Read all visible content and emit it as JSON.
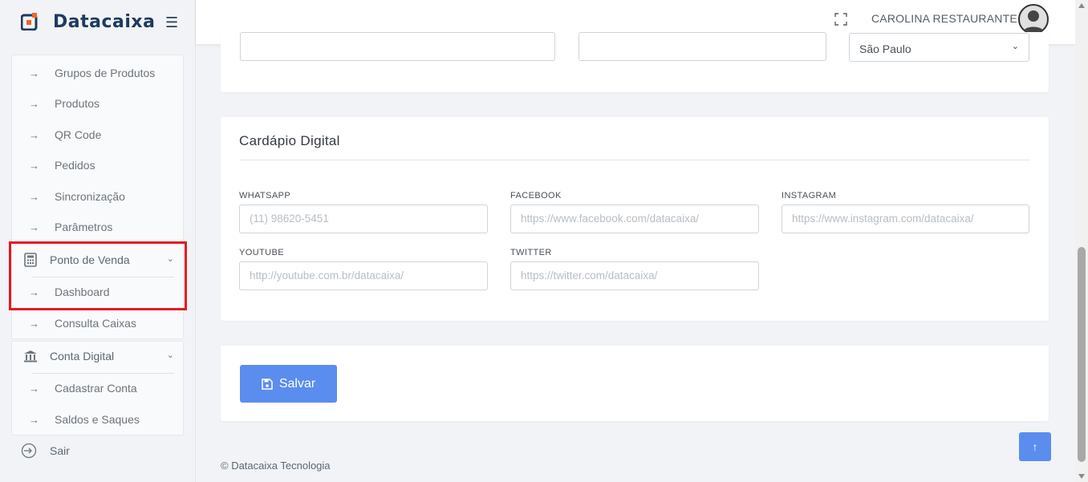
{
  "brand": {
    "name": "Datacaixa",
    "accent": "#f26522",
    "primary": "#1e3a5f"
  },
  "header": {
    "user_name": "CAROLINA RESTAURANTE"
  },
  "sidebar": {
    "produtos_items": [
      {
        "label": "Grupos de Produtos"
      },
      {
        "label": "Produtos"
      },
      {
        "label": "QR Code"
      },
      {
        "label": "Pedidos"
      },
      {
        "label": "Sincronização"
      },
      {
        "label": "Parâmetros"
      }
    ],
    "ponto_venda": {
      "label": "Ponto de Venda",
      "icon": "calculator-icon",
      "items": [
        {
          "label": "Dashboard"
        },
        {
          "label": "Consulta Caixas"
        }
      ]
    },
    "conta_digital": {
      "label": "Conta Digital",
      "icon": "bank-icon",
      "items": [
        {
          "label": "Cadastrar Conta"
        },
        {
          "label": "Saldos e Saques"
        }
      ]
    },
    "logout": {
      "label": "Sair"
    }
  },
  "address_card": {
    "state_value": "São Paulo"
  },
  "cardapio": {
    "title": "Cardápio Digital",
    "fields": {
      "whatsapp": {
        "label": "WHATSAPP",
        "placeholder": "(11) 98620-5451"
      },
      "facebook": {
        "label": "FACEBOOK",
        "placeholder": "https://www.facebook.com/datacaixa/"
      },
      "instagram": {
        "label": "INSTAGRAM",
        "placeholder": "https://www.instagram.com/datacaixa/"
      },
      "youtube": {
        "label": "YOUTUBE",
        "placeholder": "http://youtube.com.br/datacaixa/"
      },
      "twitter": {
        "label": "TWITTER",
        "placeholder": "https://twitter.com/datacaixa/"
      }
    }
  },
  "actions": {
    "save_label": "Salvar"
  },
  "footer": {
    "copyright": "© Datacaixa Tecnologia"
  },
  "colors": {
    "button": "#5b8def",
    "highlight": "#e31b23"
  }
}
